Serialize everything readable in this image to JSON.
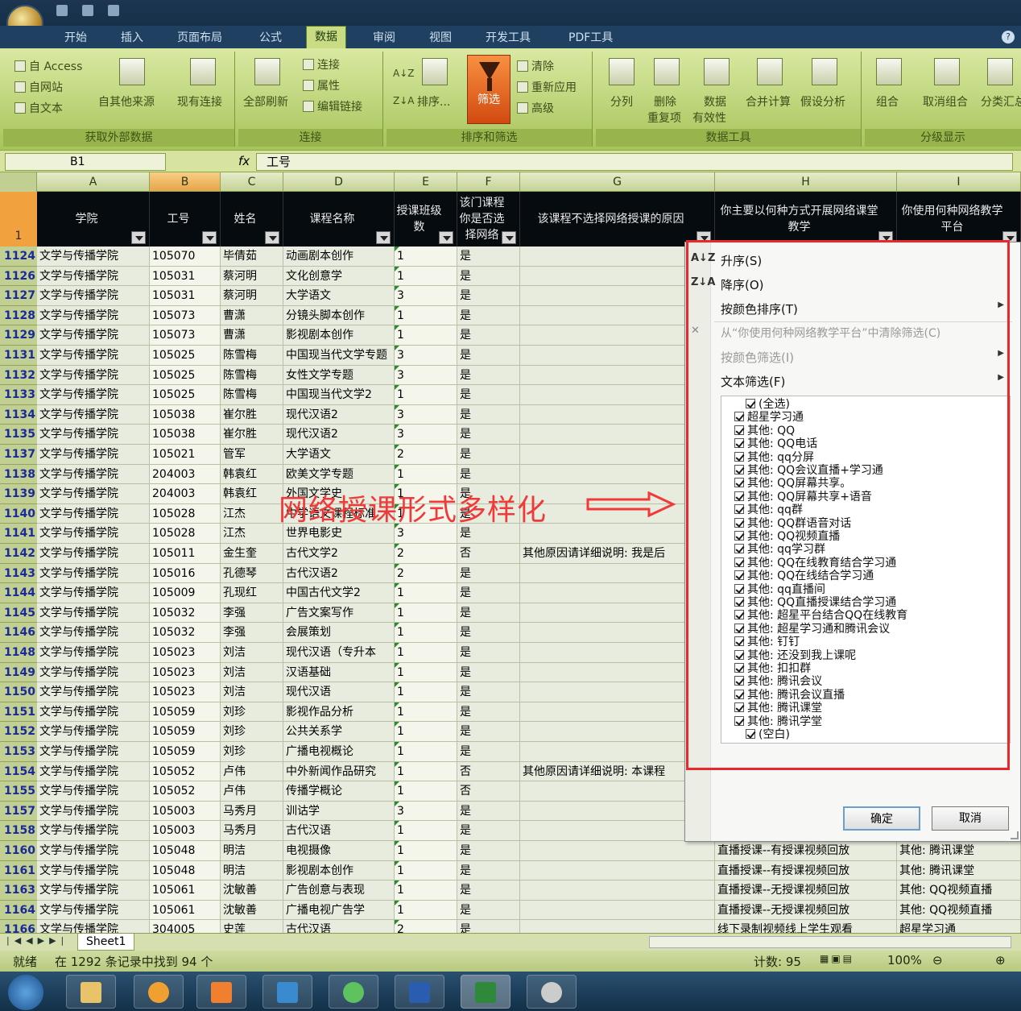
{
  "ribbon": {
    "tabs": [
      "开始",
      "插入",
      "页面布局",
      "公式",
      "数据",
      "审阅",
      "视图",
      "开发工具",
      "PDF工具"
    ],
    "active_tab": "数据",
    "groups": {
      "external": {
        "label": "获取外部数据",
        "from_access": "自 Access",
        "from_web": "自网站",
        "from_text": "自文本",
        "from_other": "自其他来源",
        "existing": "现有连接"
      },
      "connections": {
        "label": "连接",
        "refresh_all": "全部刷新",
        "connections": "连接",
        "properties": "属性",
        "edit_links": "编辑链接"
      },
      "sort_filter": {
        "label": "排序和筛选",
        "sort": "排序...",
        "filter": "筛选",
        "clear": "清除",
        "reapply": "重新应用",
        "advanced": "高级"
      },
      "data_tools": {
        "label": "数据工具",
        "split": "分列",
        "remove_dup_1": "删除",
        "remove_dup_2": "重复项",
        "validation_1": "数据",
        "validation_2": "有效性",
        "consolidate": "合并计算",
        "whatif": "假设分析"
      },
      "outline": {
        "label": "分级显示",
        "group": "组合",
        "ungroup": "取消组合",
        "subtotal": "分类汇总"
      }
    }
  },
  "formula_bar": {
    "name_box": "B1",
    "fx": "fx",
    "content": "工号"
  },
  "columns": [
    "A",
    "B",
    "C",
    "D",
    "E",
    "F",
    "G",
    "H",
    "I"
  ],
  "header_row": {
    "row_num": "1",
    "cells": [
      "学院",
      "工号",
      "姓名",
      "课程名称",
      "授课班级数",
      "该门课程你是否选择网络",
      "该课程不选择网络授课的原因",
      "你主要以何种方式开展网络课堂教学",
      "你使用何种网络教学平台"
    ]
  },
  "rows": [
    {
      "n": "1124",
      "a": "文学与传播学院",
      "b": "105070",
      "c": "毕倩茹",
      "d": "动画剧本创作",
      "e": "1",
      "f": "是",
      "g": "",
      "h": "",
      "i": ""
    },
    {
      "n": "1126",
      "a": "文学与传播学院",
      "b": "105031",
      "c": "蔡河明",
      "d": "文化创意学",
      "e": "1",
      "f": "是",
      "g": "",
      "h": "",
      "i": ""
    },
    {
      "n": "1127",
      "a": "文学与传播学院",
      "b": "105031",
      "c": "蔡河明",
      "d": "大学语文",
      "e": "3",
      "f": "是",
      "g": "",
      "h": "",
      "i": ""
    },
    {
      "n": "1128",
      "a": "文学与传播学院",
      "b": "105073",
      "c": "曹潇",
      "d": "分镜头脚本创作",
      "e": "1",
      "f": "是",
      "g": "",
      "h": "",
      "i": ""
    },
    {
      "n": "1129",
      "a": "文学与传播学院",
      "b": "105073",
      "c": "曹潇",
      "d": "影视剧本创作",
      "e": "1",
      "f": "是",
      "g": "",
      "h": "",
      "i": ""
    },
    {
      "n": "1131",
      "a": "文学与传播学院",
      "b": "105025",
      "c": "陈雪梅",
      "d": "中国现当代文学专题",
      "e": "3",
      "f": "是",
      "g": "",
      "h": "",
      "i": ""
    },
    {
      "n": "1132",
      "a": "文学与传播学院",
      "b": "105025",
      "c": "陈雪梅",
      "d": "女性文学专题",
      "e": "3",
      "f": "是",
      "g": "",
      "h": "",
      "i": ""
    },
    {
      "n": "1133",
      "a": "文学与传播学院",
      "b": "105025",
      "c": "陈雪梅",
      "d": "中国现当代文学2",
      "e": "1",
      "f": "是",
      "g": "",
      "h": "",
      "i": ""
    },
    {
      "n": "1134",
      "a": "文学与传播学院",
      "b": "105038",
      "c": "崔尔胜",
      "d": "现代汉语2",
      "e": "3",
      "f": "是",
      "g": "",
      "h": "",
      "i": ""
    },
    {
      "n": "1135",
      "a": "文学与传播学院",
      "b": "105038",
      "c": "崔尔胜",
      "d": "现代汉语2",
      "e": "3",
      "f": "是",
      "g": "",
      "h": "",
      "i": ""
    },
    {
      "n": "1137",
      "a": "文学与传播学院",
      "b": "105021",
      "c": "管军",
      "d": "大学语文",
      "e": "2",
      "f": "是",
      "g": "",
      "h": "",
      "i": ""
    },
    {
      "n": "1138",
      "a": "文学与传播学院",
      "b": "204003",
      "c": "韩袁红",
      "d": "欧美文学专题",
      "e": "1",
      "f": "是",
      "g": "",
      "h": "",
      "i": ""
    },
    {
      "n": "1139",
      "a": "文学与传播学院",
      "b": "204003",
      "c": "韩袁红",
      "d": "外国文学史",
      "e": "1",
      "f": "是",
      "g": "",
      "h": "",
      "i": ""
    },
    {
      "n": "1140",
      "a": "文学与传播学院",
      "b": "105028",
      "c": "江杰",
      "d": "中学语文课程标准",
      "e": "1",
      "f": "是",
      "g": "",
      "h": "",
      "i": ""
    },
    {
      "n": "1141",
      "a": "文学与传播学院",
      "b": "105028",
      "c": "江杰",
      "d": "世界电影史",
      "e": "3",
      "f": "是",
      "g": "",
      "h": "",
      "i": ""
    },
    {
      "n": "1142",
      "a": "文学与传播学院",
      "b": "105011",
      "c": "金生奎",
      "d": "古代文学2",
      "e": "2",
      "f": "否",
      "g": "其他原因请详细说明: 我是后",
      "h": "",
      "i": ""
    },
    {
      "n": "1143",
      "a": "文学与传播学院",
      "b": "105016",
      "c": "孔德琴",
      "d": "古代汉语2",
      "e": "2",
      "f": "是",
      "g": "",
      "h": "",
      "i": ""
    },
    {
      "n": "1144",
      "a": "文学与传播学院",
      "b": "105009",
      "c": "孔现红",
      "d": "中国古代文学2",
      "e": "1",
      "f": "是",
      "g": "",
      "h": "",
      "i": ""
    },
    {
      "n": "1145",
      "a": "文学与传播学院",
      "b": "105032",
      "c": "李强",
      "d": "广告文案写作",
      "e": "1",
      "f": "是",
      "g": "",
      "h": "",
      "i": ""
    },
    {
      "n": "1146",
      "a": "文学与传播学院",
      "b": "105032",
      "c": "李强",
      "d": "会展策划",
      "e": "1",
      "f": "是",
      "g": "",
      "h": "",
      "i": ""
    },
    {
      "n": "1148",
      "a": "文学与传播学院",
      "b": "105023",
      "c": "刘洁",
      "d": "现代汉语（专升本",
      "e": "1",
      "f": "是",
      "g": "",
      "h": "",
      "i": ""
    },
    {
      "n": "1149",
      "a": "文学与传播学院",
      "b": "105023",
      "c": "刘洁",
      "d": "汉语基础",
      "e": "1",
      "f": "是",
      "g": "",
      "h": "",
      "i": ""
    },
    {
      "n": "1150",
      "a": "文学与传播学院",
      "b": "105023",
      "c": "刘洁",
      "d": "现代汉语",
      "e": "1",
      "f": "是",
      "g": "",
      "h": "",
      "i": ""
    },
    {
      "n": "1151",
      "a": "文学与传播学院",
      "b": "105059",
      "c": "刘珍",
      "d": "影视作品分析",
      "e": "1",
      "f": "是",
      "g": "",
      "h": "",
      "i": ""
    },
    {
      "n": "1152",
      "a": "文学与传播学院",
      "b": "105059",
      "c": "刘珍",
      "d": "公共关系学",
      "e": "1",
      "f": "是",
      "g": "",
      "h": "",
      "i": ""
    },
    {
      "n": "1153",
      "a": "文学与传播学院",
      "b": "105059",
      "c": "刘珍",
      "d": "广播电视概论",
      "e": "1",
      "f": "是",
      "g": "",
      "h": "",
      "i": ""
    },
    {
      "n": "1154",
      "a": "文学与传播学院",
      "b": "105052",
      "c": "卢伟",
      "d": "中外新闻作品研究",
      "e": "1",
      "f": "否",
      "g": "其他原因请详细说明: 本课程",
      "h": "",
      "i": ""
    },
    {
      "n": "1155",
      "a": "文学与传播学院",
      "b": "105052",
      "c": "卢伟",
      "d": "传播学概论",
      "e": "1",
      "f": "否",
      "g": "",
      "h": "",
      "i": ""
    },
    {
      "n": "1157",
      "a": "文学与传播学院",
      "b": "105003",
      "c": "马秀月",
      "d": "训诂学",
      "e": "3",
      "f": "是",
      "g": "",
      "h": "",
      "i": ""
    },
    {
      "n": "1158",
      "a": "文学与传播学院",
      "b": "105003",
      "c": "马秀月",
      "d": "古代汉语",
      "e": "1",
      "f": "是",
      "g": "",
      "h": "",
      "i": ""
    },
    {
      "n": "1160",
      "a": "文学与传播学院",
      "b": "105048",
      "c": "明洁",
      "d": "电视摄像",
      "e": "1",
      "f": "是",
      "g": "",
      "h": "直播授课--有授课视频回放",
      "i": "其他: 腾讯课堂"
    },
    {
      "n": "1161",
      "a": "文学与传播学院",
      "b": "105048",
      "c": "明洁",
      "d": "影视剧本创作",
      "e": "1",
      "f": "是",
      "g": "",
      "h": "直播授课--有授课视频回放",
      "i": "其他: 腾讯课堂"
    },
    {
      "n": "1163",
      "a": "文学与传播学院",
      "b": "105061",
      "c": "沈敏善",
      "d": "广告创意与表现",
      "e": "1",
      "f": "是",
      "g": "",
      "h": "直播授课--无授课视频回放",
      "i": "其他: QQ视频直播"
    },
    {
      "n": "1164",
      "a": "文学与传播学院",
      "b": "105061",
      "c": "沈敏善",
      "d": "广播电视广告学",
      "e": "1",
      "f": "是",
      "g": "",
      "h": "直播授课--无授课视频回放",
      "i": "其他: QQ视频直播"
    },
    {
      "n": "1166",
      "a": "文学与传播学院",
      "b": "304005",
      "c": "史莲",
      "d": "古代汉语",
      "e": "2",
      "f": "是",
      "g": "",
      "h": "线下录制视频线上学生观看",
      "i": "超星学习通"
    }
  ],
  "annotation": {
    "text": "网络授课形式多样化"
  },
  "filter_menu": {
    "sort_asc": "升序(S)",
    "sort_desc": "降序(O)",
    "sort_color": "按颜色排序(T)",
    "clear_filter": "从“你使用何种网络教学平台”中清除筛选(C)",
    "filter_color": "按颜色筛选(I)",
    "text_filter": "文本筛选(F)",
    "items": [
      "(全选)",
      "超星学习通",
      "其他: QQ",
      "其他: QQ电话",
      "其他: qq分屏",
      "其他: QQ会议直播+学习通",
      "其他: QQ屏幕共享。",
      "其他: QQ屏幕共享+语音",
      "其他: qq群",
      "其他: QQ群语音对话",
      "其他: QQ视频直播",
      "其他: qq学习群",
      "其他: QQ在线教育结合学习通",
      "其他: QQ在线结合学习通",
      "其他: qq直播间",
      "其他: QQ直播授课结合学习通",
      "其他: 超星平台结合QQ在线教育",
      "其他: 超星学习通和腾讯会议",
      "其他: 钉钉",
      "其他: 还没到我上课呢",
      "其他: 扣扣群",
      "其他: 腾讯会议",
      "其他: 腾讯会议直播",
      "其他: 腾讯课堂",
      "其他: 腾讯学堂",
      "(空白)"
    ],
    "ok": "确定",
    "cancel": "取消"
  },
  "sheet_tab": "Sheet1",
  "status": {
    "ready": "就绪",
    "found": "在 1292 条记录中找到 94 个",
    "count": "计数: 95",
    "zoom": "100%"
  },
  "colors": {
    "accent_red": "#e8282a",
    "filter_orange": "#f08a3c",
    "ribbon_green": "#c9dc83"
  }
}
